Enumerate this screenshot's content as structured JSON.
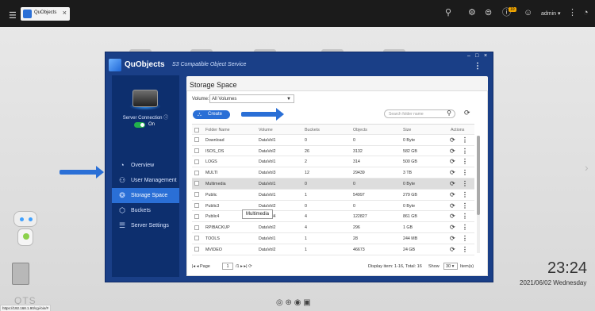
{
  "topbar": {
    "tab_label": "QuObjects",
    "tab_close": "×",
    "notification_count": "10",
    "user_name": "admin ▾"
  },
  "window": {
    "minimize": "–",
    "maximize": "□",
    "close": "×",
    "app_title": "QuObjects",
    "app_subtitle": "S3 Compatible Object Service",
    "kebab": "⋮"
  },
  "sidebar": {
    "server_connection_label": "Server Connection",
    "toggle_label": "On",
    "items": [
      {
        "label": "Overview",
        "icon": "overview-icon",
        "glyph": "◔"
      },
      {
        "label": "User Management",
        "icon": "users-icon",
        "glyph": "👥"
      },
      {
        "label": "Storage Space",
        "icon": "storage-icon",
        "glyph": "❂"
      },
      {
        "label": "Buckets",
        "icon": "bucket-icon",
        "glyph": "⬡"
      },
      {
        "label": "Server Settings",
        "icon": "settings-icon",
        "glyph": "☰"
      }
    ]
  },
  "main": {
    "title": "Storage Space",
    "volume_label": "Volume:",
    "volume_value": "All Volumes",
    "create_label": "Create",
    "search_placeholder": "Search folder name",
    "columns": [
      "Folder Name",
      "Volume",
      "Buckets",
      "Objects",
      "Size",
      "Actions"
    ],
    "rows": [
      {
        "name": "Download",
        "volume": "DataVol1",
        "buckets": "0",
        "objects": "0",
        "size": "0 Byte"
      },
      {
        "name": "ISOS_OS",
        "volume": "DataVol2",
        "buckets": "26",
        "objects": "3132",
        "size": "582 GB"
      },
      {
        "name": "LOGS",
        "volume": "DataVol1",
        "buckets": "2",
        "objects": "314",
        "size": "500 GB"
      },
      {
        "name": "MULTI",
        "volume": "DataVol3",
        "buckets": "12",
        "objects": "29439",
        "size": "3 TB"
      },
      {
        "name": "Multimedia",
        "volume": "DataVol1",
        "buckets": "0",
        "objects": "0",
        "size": "0 Byte"
      },
      {
        "name": "Public",
        "volume": "DataVol1",
        "buckets": "1",
        "objects": "54997",
        "size": "279 GB"
      },
      {
        "name": "Public3",
        "volume": "DataVol2",
        "buckets": "0",
        "objects": "0",
        "size": "0 Byte"
      },
      {
        "name": "Public4",
        "volume": "DataVol4",
        "buckets": "4",
        "objects": "122827",
        "size": "861 GB"
      },
      {
        "name": "RPIBACKUP",
        "volume": "DataVol2",
        "buckets": "4",
        "objects": "296",
        "size": "1 GB"
      },
      {
        "name": "TOOLS",
        "volume": "DataVol1",
        "buckets": "1",
        "objects": "28",
        "size": "244 MB"
      },
      {
        "name": "MVIDEO",
        "volume": "DataVol2",
        "buckets": "1",
        "objects": "46673",
        "size": "24 GB"
      }
    ],
    "tooltip": "Multimedia",
    "pager_prefix": "Page",
    "page_value": "1",
    "pager_suffix": "/1",
    "display_info": "Display item: 1-16, Total: 16",
    "show_label": "Show",
    "show_value": "30",
    "items_label": "Item(s)"
  },
  "desktop": {
    "time": "23:24",
    "date": "2021/06/02 Wednesday",
    "os_label": "QTS",
    "status_url": "https://192.168.1.90/cgi-bin/#"
  }
}
